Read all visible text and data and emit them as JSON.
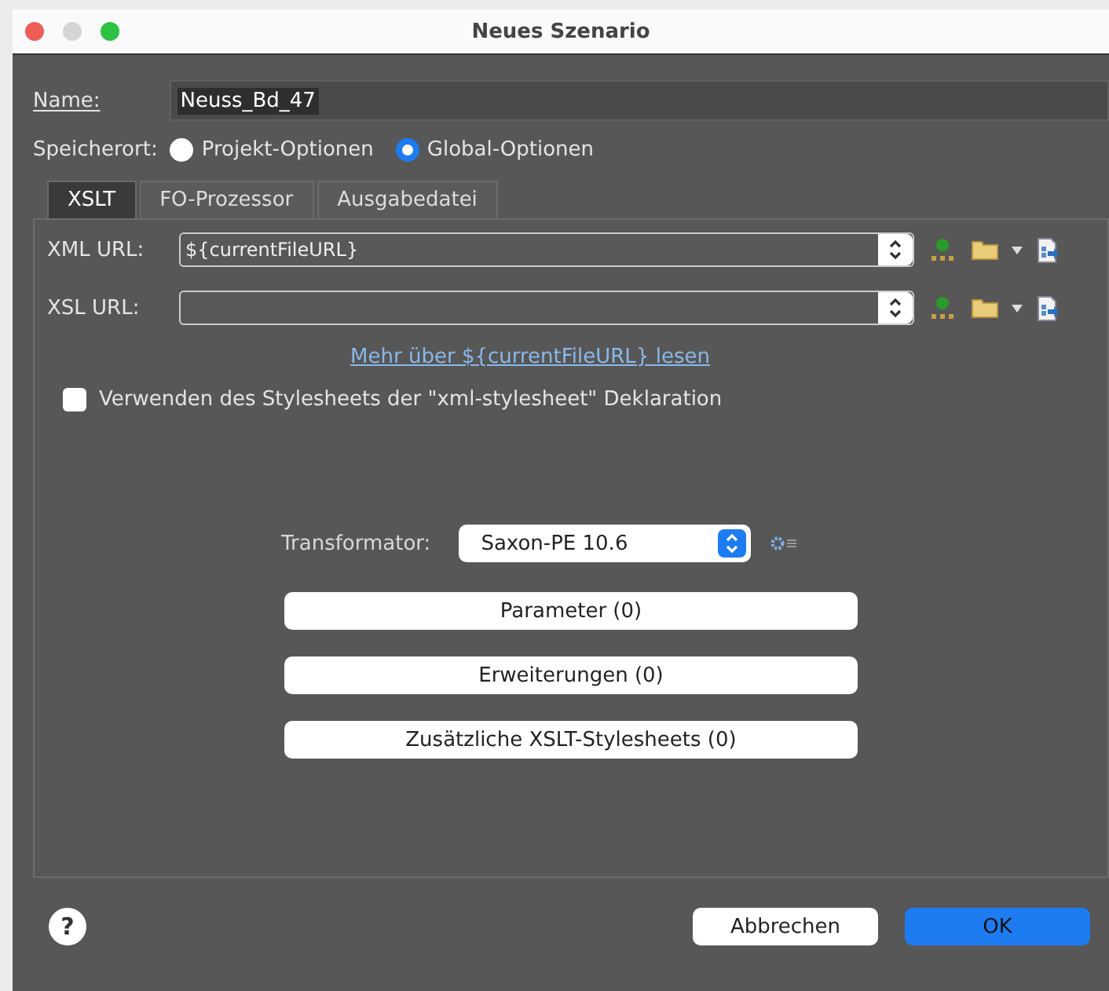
{
  "window": {
    "title": "Neues Szenario"
  },
  "name_field": {
    "label": "Name:",
    "value": "Neuss_Bd_47"
  },
  "storage": {
    "label": "Speicherort:",
    "options": [
      {
        "label": "Projekt-Optionen",
        "selected": false
      },
      {
        "label": "Global-Optionen",
        "selected": true
      }
    ]
  },
  "tabs": [
    {
      "label": "XSLT",
      "selected": true
    },
    {
      "label": "FO-Prozessor",
      "selected": false
    },
    {
      "label": "Ausgabedatei",
      "selected": false
    }
  ],
  "url_rows": [
    {
      "label": "XML URL:",
      "value": "${currentFileURL}"
    },
    {
      "label": "XSL URL:"
    }
  ],
  "link": "Mehr über ${currentFileURL} lesen",
  "stylesheet_checkbox": {
    "label": "Verwenden des Stylesheets der \"xml-stylesheet\" Deklaration",
    "checked": false
  },
  "transformer": {
    "label": "Transformator:",
    "value": "Saxon-PE 10.6"
  },
  "buttons": [
    "Parameter (0)",
    "Erweiterungen (0)",
    "Zusätzliche XSLT-Stylesheets (0)"
  ],
  "footer": {
    "help": "?",
    "cancel": "Abbrechen",
    "ok": "OK"
  }
}
